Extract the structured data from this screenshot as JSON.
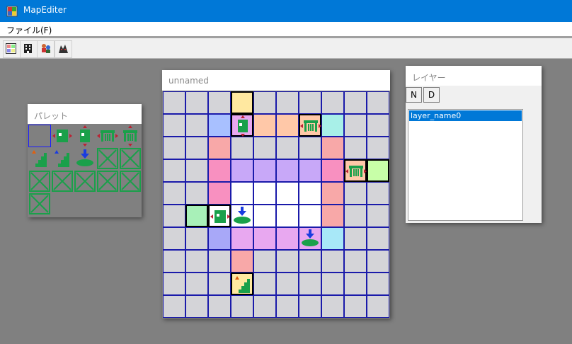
{
  "app": {
    "title": "MapEditer"
  },
  "menu": {
    "file": "ファイル(F)"
  },
  "toolbar": {
    "buttons": [
      "map-icon",
      "building-icon",
      "character-icon",
      "monster-icon"
    ]
  },
  "palette": {
    "title": "パレット",
    "tiles": [
      "empty-selected",
      "door-both-arrows",
      "door-vertical-arrows",
      "gate-both-arrows",
      "gate-vertical-arrows",
      "stairs-up-orange",
      "stairs-down-blue",
      "pit-down-arrow",
      "blank-tile",
      "blank-tile",
      "blank-tile",
      "blank-tile",
      "blank-tile",
      "blank-tile",
      "blank-tile",
      "blank-tile"
    ]
  },
  "map": {
    "title": "unnamed",
    "cols": 10,
    "rows": 10,
    "cells": [
      [
        "g",
        "g",
        "g",
        "#ffe8a0",
        "g",
        "g",
        "g",
        "g",
        "g",
        "g"
      ],
      [
        "g",
        "g",
        "#a8c0ff",
        "#e8a8f0",
        "#ffc8a8",
        "#ffc8a8",
        "#ffc8a8",
        "#a8f0e8",
        "g",
        "g"
      ],
      [
        "g",
        "g",
        "#f8a8a8",
        "g",
        "g",
        "g",
        "g",
        "#f8a8a8",
        "g",
        "g"
      ],
      [
        "g",
        "g",
        "#f890c0",
        "#c8a8f8",
        "#c8a8f8",
        "#c8a8f8",
        "#c8a8f8",
        "#f890c0",
        "#ffc8a8",
        "#c8ffa8"
      ],
      [
        "g",
        "g",
        "#f890c0",
        "#ffffff",
        "#ffffff",
        "#ffffff",
        "#ffffff",
        "#f8a8a8",
        "g",
        "g"
      ],
      [
        "g",
        "#a8f0b8",
        "#ffffff",
        "#ffffff",
        "#ffffff",
        "#ffffff",
        "#ffffff",
        "#f8a8a8",
        "g",
        "g"
      ],
      [
        "g",
        "g",
        "#a8a8f8",
        "#e8a8f0",
        "#e8a8f0",
        "#e8a8f0",
        "#e8a8f0",
        "#a8e8f8",
        "g",
        "g"
      ],
      [
        "g",
        "g",
        "g",
        "#f8a8a8",
        "g",
        "g",
        "g",
        "g",
        "g",
        "g"
      ],
      [
        "g",
        "g",
        "g",
        "#ffe8a0",
        "g",
        "g",
        "g",
        "g",
        "g",
        "g"
      ],
      [
        "g",
        "g",
        "g",
        "g",
        "g",
        "g",
        "g",
        "g",
        "g",
        "g"
      ]
    ],
    "objects": [
      {
        "row": 1,
        "col": 3,
        "icon": "door-vertical-icon"
      },
      {
        "row": 1,
        "col": 6,
        "icon": "gate-icon"
      },
      {
        "row": 3,
        "col": 8,
        "icon": "gate-icon"
      },
      {
        "row": 5,
        "col": 2,
        "icon": "door-horizontal-icon"
      },
      {
        "row": 5,
        "col": 3,
        "icon": "pit-icon"
      },
      {
        "row": 6,
        "col": 6,
        "icon": "pit-icon"
      },
      {
        "row": 8,
        "col": 3,
        "icon": "stairs-up-icon"
      }
    ],
    "selected": [
      {
        "row": 0,
        "col": 3
      },
      {
        "row": 1,
        "col": 3
      },
      {
        "row": 1,
        "col": 6
      },
      {
        "row": 3,
        "col": 8
      },
      {
        "row": 3,
        "col": 9
      },
      {
        "row": 5,
        "col": 1
      },
      {
        "row": 5,
        "col": 2
      },
      {
        "row": 8,
        "col": 3
      }
    ]
  },
  "layers": {
    "title": "レイヤー",
    "buttons": {
      "n": "N",
      "d": "D"
    },
    "items": [
      "layer_name0"
    ]
  },
  "colors": {
    "titlebar": "#0078d7",
    "gridBorder": "#1a1aaa",
    "emptyCell": "#d4d4d8",
    "workspace": "#808080"
  }
}
